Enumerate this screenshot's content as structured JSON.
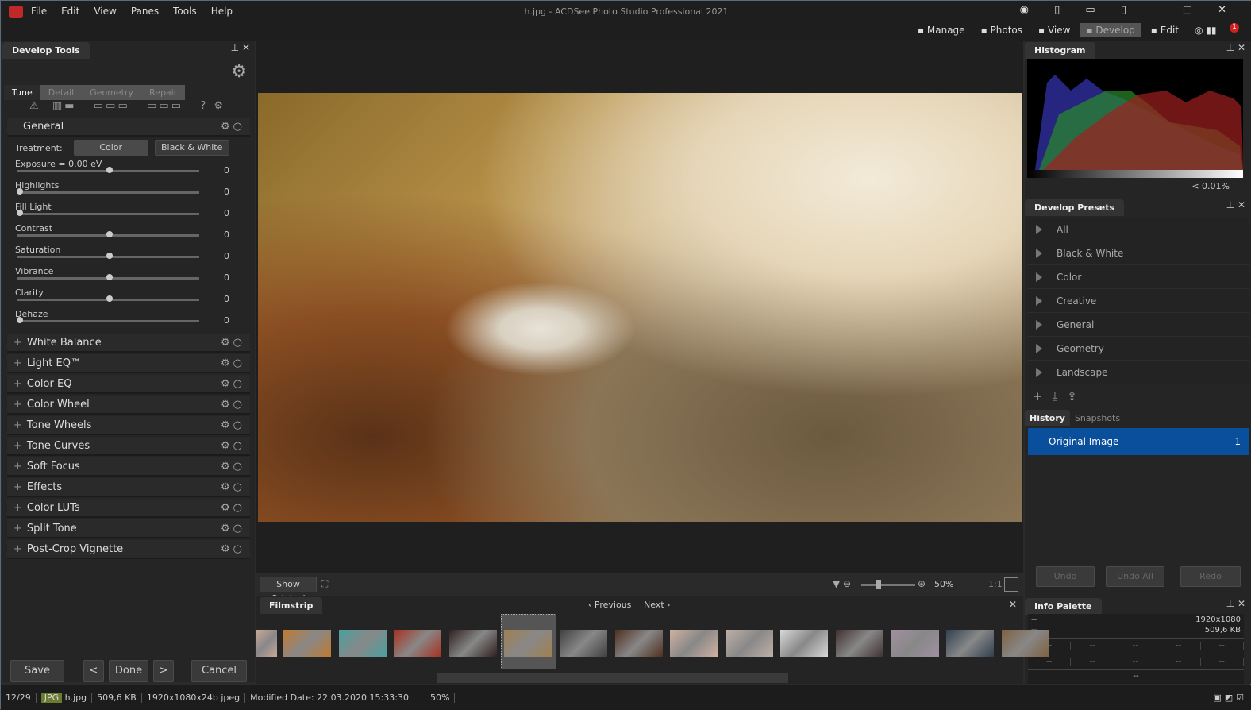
{
  "window": {
    "title": "h.jpg - ACDSee Photo Studio Professional 2021"
  },
  "menu": [
    "File",
    "Edit",
    "View",
    "Panes",
    "Tools",
    "Help"
  ],
  "modes": [
    {
      "label": "Manage",
      "icon": "grid-icon"
    },
    {
      "label": "Photos",
      "icon": "photos-icon"
    },
    {
      "label": "View",
      "icon": "eye-icon"
    },
    {
      "label": "Develop",
      "icon": "develop-icon",
      "active": true
    },
    {
      "label": "Edit",
      "icon": "edit-icon"
    }
  ],
  "notification_count": "1",
  "develop_tools": {
    "title": "Develop Tools",
    "tabs": [
      "Tune",
      "Detail",
      "Geometry",
      "Repair"
    ],
    "active_tab": "Tune",
    "general": {
      "title": "General",
      "treatment_label": "Treatment:",
      "treatment_options": [
        "Color",
        "Black & White"
      ],
      "treatment_selected": "Color",
      "sliders": [
        {
          "label": "Exposure = 0.00 eV",
          "value": "0",
          "position": 0.5
        },
        {
          "label": "Highlights",
          "value": "0",
          "position": 0
        },
        {
          "label": "Fill Light",
          "value": "0",
          "position": 0
        },
        {
          "label": "Contrast",
          "value": "0",
          "position": 0.5
        },
        {
          "label": "Saturation",
          "value": "0",
          "position": 0.5
        },
        {
          "label": "Vibrance",
          "value": "0",
          "position": 0.5
        },
        {
          "label": "Clarity",
          "value": "0",
          "position": 0.5
        },
        {
          "label": "Dehaze",
          "value": "0",
          "position": 0
        }
      ]
    },
    "sections": [
      "White Balance",
      "Light EQ™",
      "Color EQ",
      "Color Wheel",
      "Tone Wheels",
      "Tone Curves",
      "Soft Focus",
      "Effects",
      "Color LUTs",
      "Split Tone",
      "Post-Crop Vignette"
    ],
    "buttons": {
      "save": "Save",
      "done": "Done",
      "cancel": "Cancel",
      "prev": "<",
      "next": ">"
    }
  },
  "viewer": {
    "show_original": "Show Original",
    "zoom": "50%",
    "ratio": "1:1",
    "zoom_slider": 0.3
  },
  "filmstrip": {
    "title": "Filmstrip",
    "previous": "Previous",
    "next": "Next",
    "thumbs": [
      "#c8a898",
      "#c07a30",
      "#4aa0a0",
      "#a83020",
      "#302020",
      "#a08050",
      "#404040",
      "#503020",
      "#d0b0a0",
      "#c0b0a8",
      "#d8d8d8",
      "#403030",
      "#a090a0",
      "#304050",
      "#806040"
    ],
    "selected_index": 5
  },
  "histogram": {
    "title": "Histogram",
    "clip": "< 0.01%"
  },
  "presets": {
    "title": "Develop Presets",
    "items": [
      "All",
      "Black & White",
      "Color",
      "Creative",
      "General",
      "Geometry",
      "Landscape"
    ]
  },
  "history": {
    "tabs": [
      "History",
      "Snapshots"
    ],
    "items": [
      {
        "label": "Original Image",
        "index": "1"
      }
    ],
    "undo": "Undo",
    "undo_all": "Undo All",
    "redo": "Redo"
  },
  "info": {
    "title": "Info Palette",
    "l1": "--",
    "l2": "--",
    "dims": "1920x1080",
    "size": "509,6 KB",
    "row": [
      "--",
      "--",
      "--",
      "--",
      "--"
    ],
    "bottom": "--"
  },
  "status": {
    "index": "12/29",
    "format": "JPG",
    "filename": "h.jpg",
    "filesize": "509,6 KB",
    "dims": "1920x1080x24b jpeg",
    "modified": "Modified Date: 22.03.2020 15:33:30",
    "zoom": "50%"
  },
  "colors": {
    "accent": "#0a4f9c",
    "active_mode": "#555555"
  }
}
